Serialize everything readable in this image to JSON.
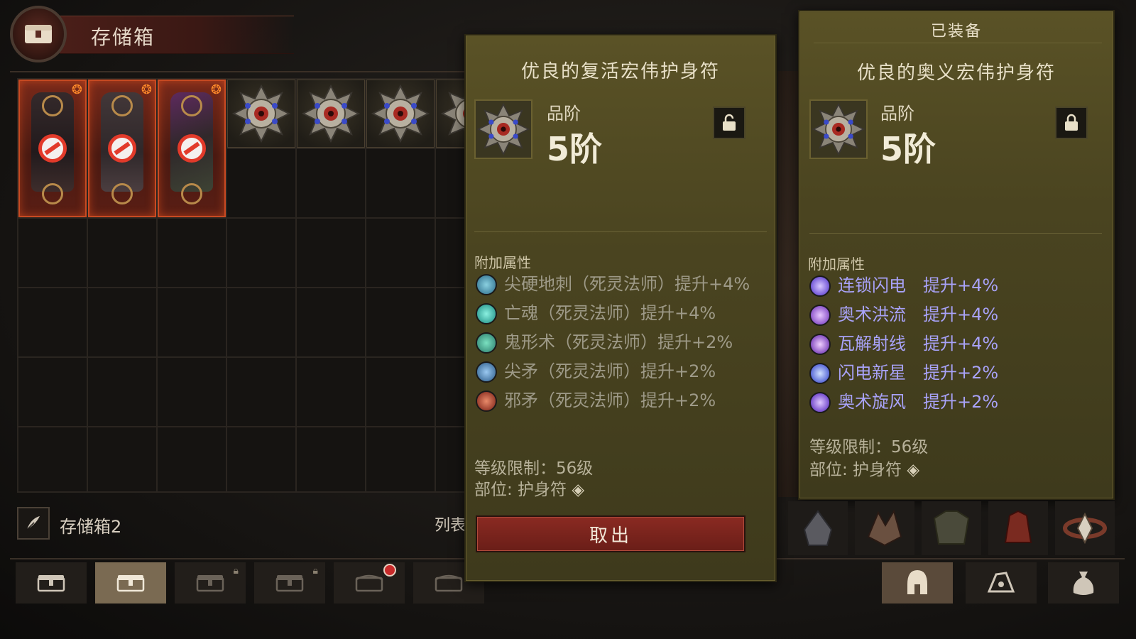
{
  "header": {
    "title": "存储箱",
    "emblem_icon": "chest-icon"
  },
  "stash": {
    "armor_items": [
      {
        "icon": "chest-armor-icon",
        "status": "not-usable"
      },
      {
        "icon": "pants-armor-icon",
        "status": "not-usable"
      },
      {
        "icon": "gloves-armor-icon",
        "status": "not-usable"
      }
    ],
    "amulet_items": [
      {
        "icon": "amulet-icon"
      },
      {
        "icon": "amulet-icon"
      },
      {
        "icon": "amulet-icon"
      },
      {
        "icon": "amulet-icon"
      }
    ],
    "footer": {
      "name": "存储箱2",
      "list_label": "列表"
    }
  },
  "tabs": [
    {
      "icon": "chest-icon",
      "active": false,
      "locked": false
    },
    {
      "icon": "chest-icon",
      "active": true,
      "locked": false
    },
    {
      "icon": "chest-icon",
      "active": false,
      "locked": true
    },
    {
      "icon": "chest-icon",
      "active": false,
      "locked": true
    },
    {
      "icon": "chest-icon",
      "active": false,
      "locked": false,
      "badge": "red"
    },
    {
      "icon": "chest-icon",
      "active": false,
      "locked": false
    }
  ],
  "compare_item": {
    "name": "优良的复活宏伟护身符",
    "grade_label": "品阶",
    "grade_value": "5阶",
    "affix_title": "附加属性",
    "affixes": [
      {
        "icon": "bone-spike-icon",
        "text": "尖硬地刺（死灵法师）提升+4%",
        "color": "#4a8aa0"
      },
      {
        "icon": "soul-icon",
        "text": "亡魂（死灵法师）提升+4%",
        "color": "#2ab0a0"
      },
      {
        "icon": "ghost-form-icon",
        "text": "鬼形术（死灵法师）提升+2%",
        "color": "#3aa090"
      },
      {
        "icon": "spear-icon",
        "text": "尖矛（死灵法师）提升+2%",
        "color": "#4a7aa8"
      },
      {
        "icon": "evil-spear-icon",
        "text": "邪矛（死灵法师）提升+2%",
        "color": "#a8382a"
      }
    ],
    "level_req": "等级限制：56级",
    "slot": "部位: 护身符",
    "take_out_button": "取出"
  },
  "equipped_item": {
    "header": "已装备",
    "name": "优良的奥义宏伟护身符",
    "grade_label": "品阶",
    "grade_value": "5阶",
    "affix_title": "附加属性",
    "affixes": [
      {
        "icon": "chain-lightning-icon",
        "text": "连锁闪电　提升+4%",
        "color": "#6a5ae8"
      },
      {
        "icon": "arcane-torrent-icon",
        "text": "奥术洪流　提升+4%",
        "color": "#7a5ad8"
      },
      {
        "icon": "disintegrate-icon",
        "text": "瓦解射线　提升+4%",
        "color": "#7a4ac8"
      },
      {
        "icon": "lightning-nova-icon",
        "text": "闪电新星　提升+2%",
        "color": "#5a6ae8"
      },
      {
        "icon": "arcane-whirlwind-icon",
        "text": "奥术旋风　提升+2%",
        "color": "#6a4ad8"
      }
    ],
    "level_req": "等级限制：56级",
    "slot": "部位: 护身符"
  },
  "gear_slots": [
    {
      "icon": "helm-icon"
    },
    {
      "icon": "shoulder-icon"
    },
    {
      "icon": "chest-armor-icon"
    },
    {
      "icon": "gloves-armor-icon"
    },
    {
      "icon": "belt-icon"
    }
  ],
  "character_tabs": [
    {
      "icon": "helmet-icon",
      "active": true
    },
    {
      "icon": "gem-icon",
      "active": false
    },
    {
      "icon": "bag-icon",
      "active": false
    }
  ],
  "colors": {
    "accent_red": "#c84a22",
    "magic_affix": "#a8a2f8",
    "tooltip_bg": "#4a4420",
    "take_button": "#7a2420"
  }
}
